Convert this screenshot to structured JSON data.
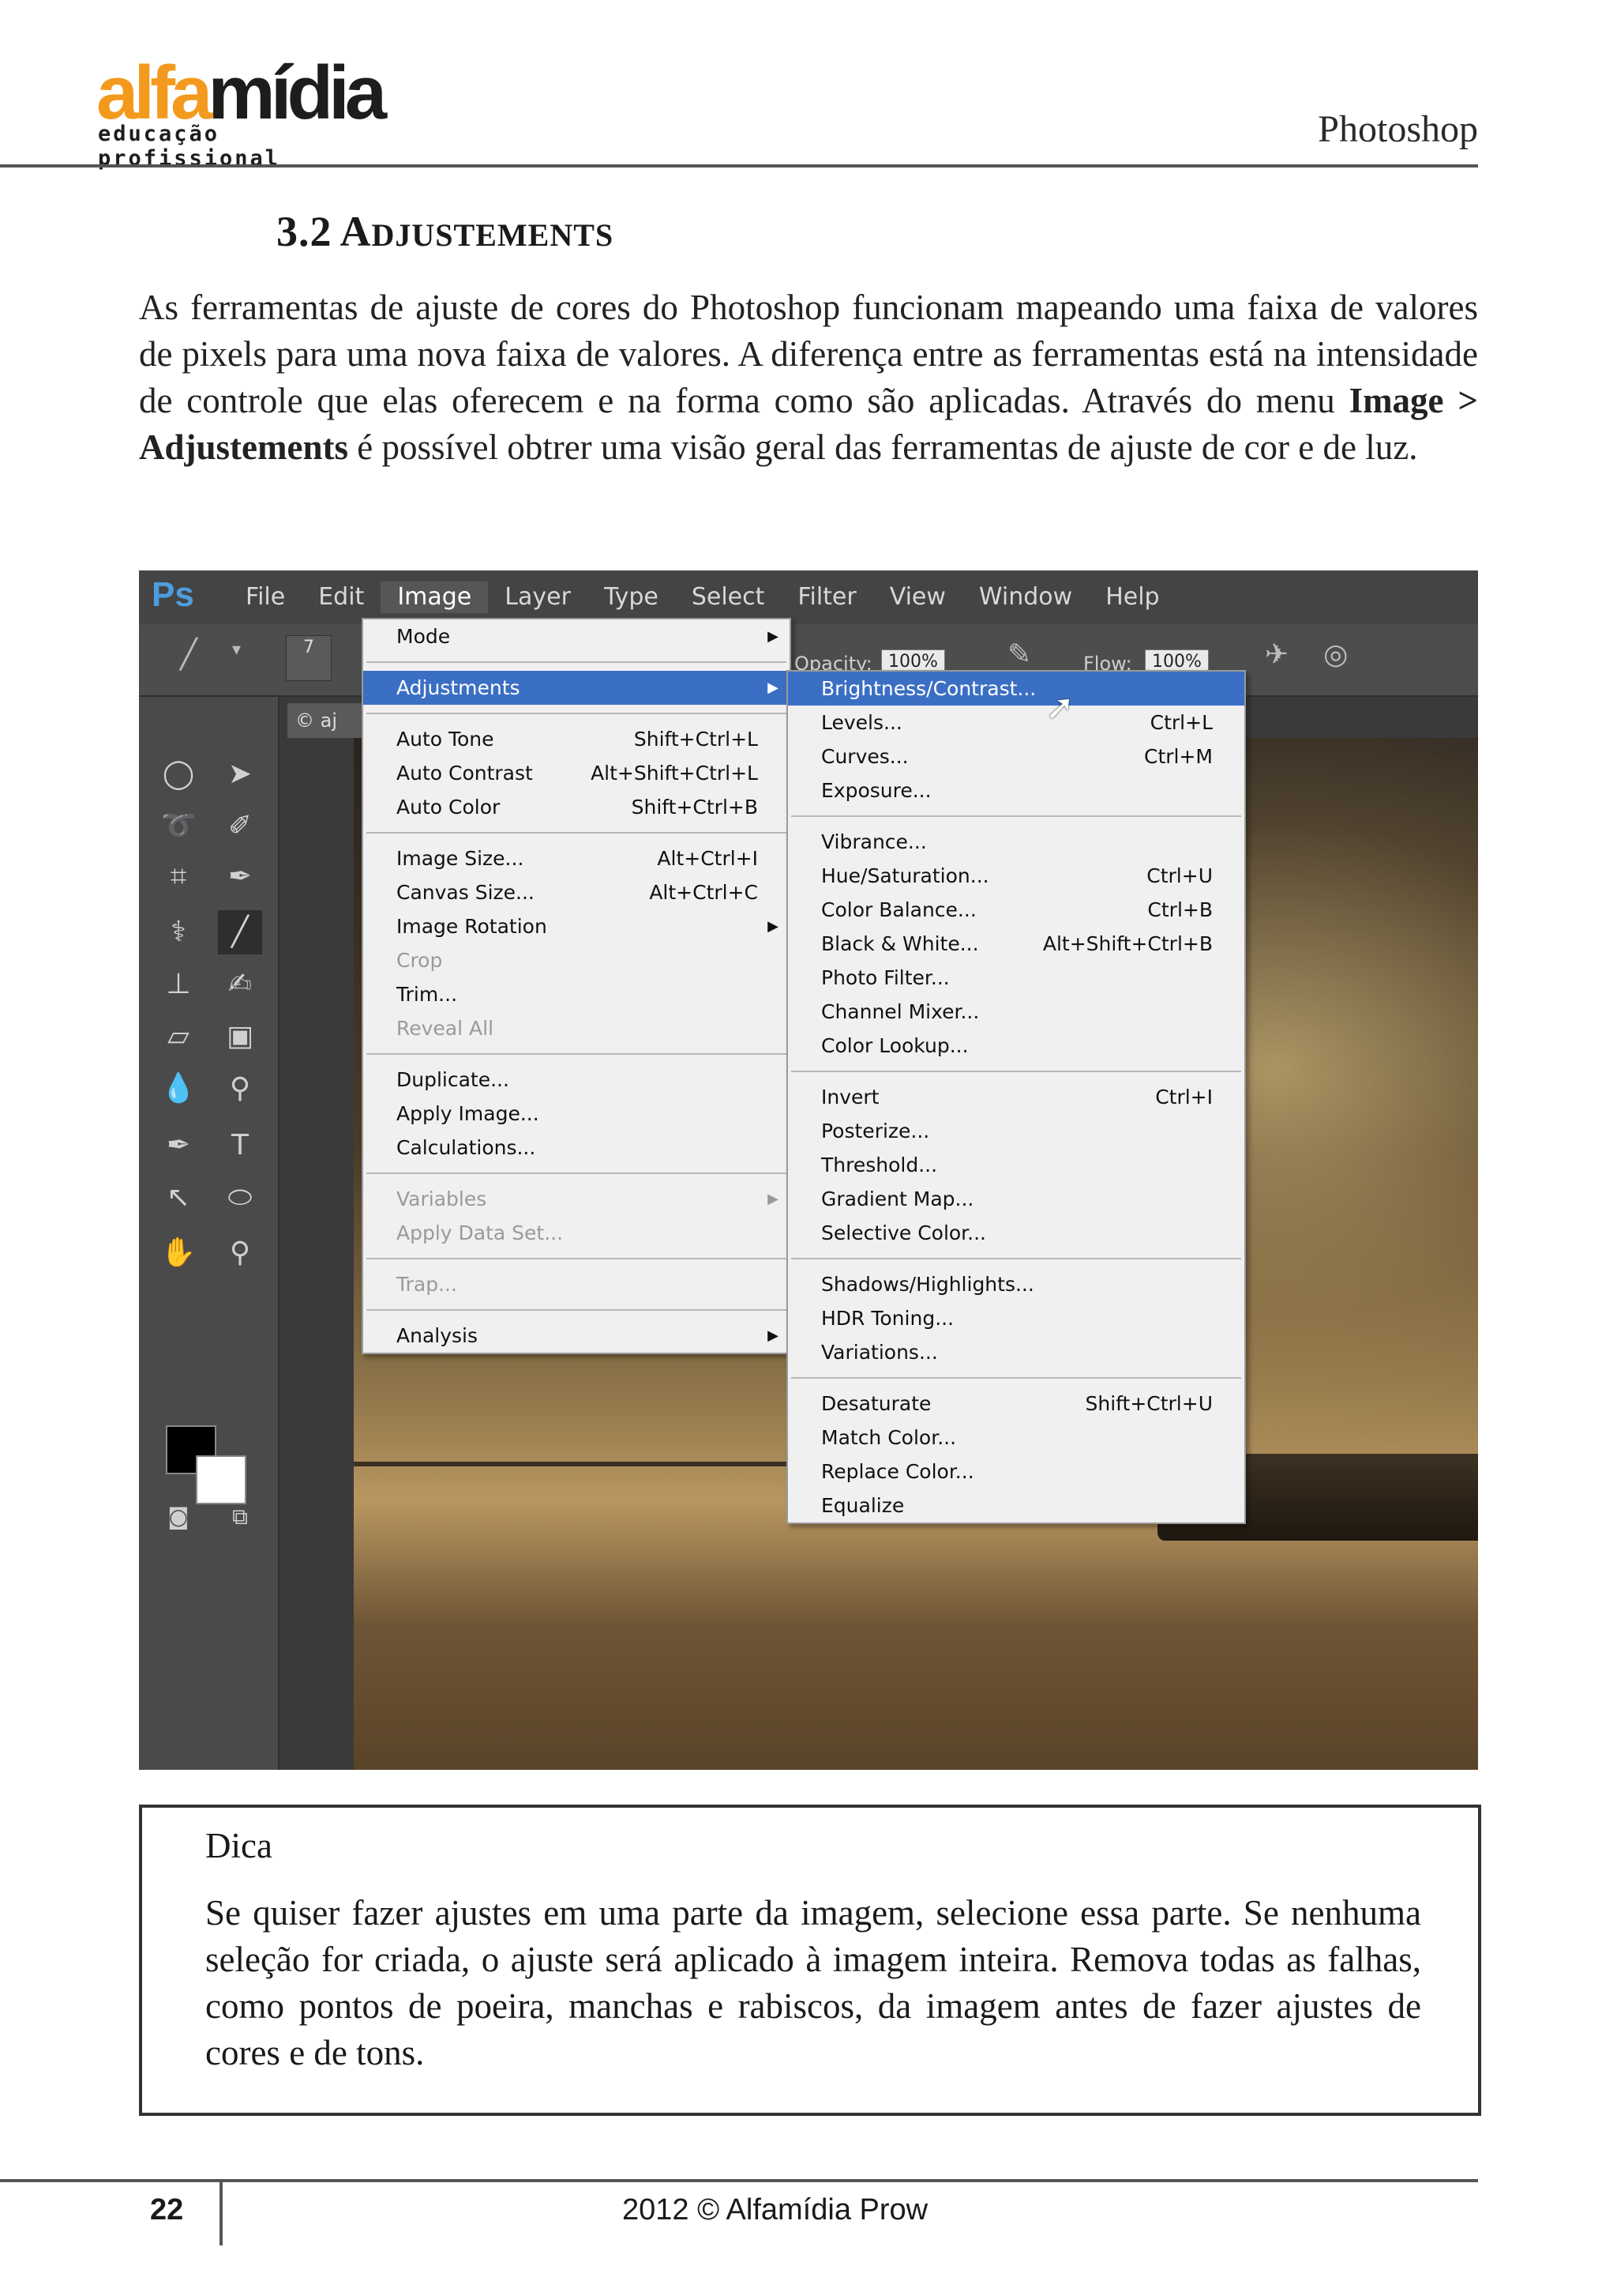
{
  "header": {
    "logo_part1": "alfa",
    "logo_part2": "mídia",
    "logo_tagline": "educação profissional",
    "title": "Photoshop"
  },
  "section": {
    "number": "3.2",
    "title_initial": "A",
    "title_rest": "DJUSTEMENTS"
  },
  "body": {
    "text_before": "As ferramentas de ajuste de cores do Photoshop funcionam mapeando uma faixa de valores de pixels para uma nova faixa de valores. A diferença entre as ferramentas está na intensidade de controle que elas oferecem e na forma como são aplicadas. Através do menu ",
    "bold_text": "Image > Adjustements",
    "text_after": " é possível obtrer uma visão geral das ferramentas de ajuste de cor e de luz."
  },
  "screenshot": {
    "ps_logo": "Ps",
    "menubar": [
      "File",
      "Edit",
      "Image",
      "Layer",
      "Type",
      "Select",
      "Filter",
      "View",
      "Window",
      "Help"
    ],
    "active_menu": "Image",
    "options": {
      "opacity_label": "Opacity:",
      "opacity_value": "100%",
      "flow_label": "Flow:",
      "flow_value": "100%",
      "brush_size": "7"
    },
    "doc_tab": "© aj",
    "image_menu": [
      {
        "label": "Mode",
        "shortcut": "",
        "submenu": true,
        "disabled": false
      },
      {
        "sep": true
      },
      {
        "label": "Adjustments",
        "shortcut": "",
        "submenu": true,
        "disabled": false,
        "highlight": true
      },
      {
        "sep": true
      },
      {
        "label": "Auto Tone",
        "shortcut": "Shift+Ctrl+L",
        "disabled": false
      },
      {
        "label": "Auto Contrast",
        "shortcut": "Alt+Shift+Ctrl+L",
        "disabled": false
      },
      {
        "label": "Auto Color",
        "shortcut": "Shift+Ctrl+B",
        "disabled": false
      },
      {
        "sep": true
      },
      {
        "label": "Image Size...",
        "shortcut": "Alt+Ctrl+I",
        "disabled": false
      },
      {
        "label": "Canvas Size...",
        "shortcut": "Alt+Ctrl+C",
        "disabled": false
      },
      {
        "label": "Image Rotation",
        "shortcut": "",
        "submenu": true,
        "disabled": false
      },
      {
        "label": "Crop",
        "shortcut": "",
        "disabled": true
      },
      {
        "label": "Trim...",
        "shortcut": "",
        "disabled": false
      },
      {
        "label": "Reveal All",
        "shortcut": "",
        "disabled": true
      },
      {
        "sep": true
      },
      {
        "label": "Duplicate...",
        "shortcut": "",
        "disabled": false
      },
      {
        "label": "Apply Image...",
        "shortcut": "",
        "disabled": false
      },
      {
        "label": "Calculations...",
        "shortcut": "",
        "disabled": false
      },
      {
        "sep": true
      },
      {
        "label": "Variables",
        "shortcut": "",
        "submenu": true,
        "disabled": true
      },
      {
        "label": "Apply Data Set...",
        "shortcut": "",
        "disabled": true
      },
      {
        "sep": true
      },
      {
        "label": "Trap...",
        "shortcut": "",
        "disabled": true
      },
      {
        "sep": true
      },
      {
        "label": "Analysis",
        "shortcut": "",
        "submenu": true,
        "disabled": false
      }
    ],
    "adjustments_menu": [
      {
        "label": "Brightness/Contrast...",
        "shortcut": "",
        "highlight": true
      },
      {
        "label": "Levels...",
        "shortcut": "Ctrl+L"
      },
      {
        "label": "Curves...",
        "shortcut": "Ctrl+M"
      },
      {
        "label": "Exposure...",
        "shortcut": ""
      },
      {
        "sep": true
      },
      {
        "label": "Vibrance...",
        "shortcut": ""
      },
      {
        "label": "Hue/Saturation...",
        "shortcut": "Ctrl+U"
      },
      {
        "label": "Color Balance...",
        "shortcut": "Ctrl+B"
      },
      {
        "label": "Black & White...",
        "shortcut": "Alt+Shift+Ctrl+B"
      },
      {
        "label": "Photo Filter...",
        "shortcut": ""
      },
      {
        "label": "Channel Mixer...",
        "shortcut": ""
      },
      {
        "label": "Color Lookup...",
        "shortcut": ""
      },
      {
        "sep": true
      },
      {
        "label": "Invert",
        "shortcut": "Ctrl+I"
      },
      {
        "label": "Posterize...",
        "shortcut": ""
      },
      {
        "label": "Threshold...",
        "shortcut": ""
      },
      {
        "label": "Gradient Map...",
        "shortcut": ""
      },
      {
        "label": "Selective Color...",
        "shortcut": ""
      },
      {
        "sep": true
      },
      {
        "label": "Shadows/Highlights...",
        "shortcut": ""
      },
      {
        "label": "HDR Toning...",
        "shortcut": ""
      },
      {
        "label": "Variations...",
        "shortcut": ""
      },
      {
        "sep": true
      },
      {
        "label": "Desaturate",
        "shortcut": "Shift+Ctrl+U"
      },
      {
        "label": "Match Color...",
        "shortcut": ""
      },
      {
        "label": "Replace Color...",
        "shortcut": ""
      },
      {
        "label": "Equalize",
        "shortcut": ""
      }
    ]
  },
  "tip": {
    "title": "Dica",
    "text": "Se quiser fazer ajustes em uma parte da imagem, selecione essa parte. Se nenhuma seleção for criada, o ajuste será aplicado à imagem inteira. Remova todas as falhas, como pontos de poeira, manchas e rabiscos, da imagem antes de fazer ajustes de cores e de tons."
  },
  "footer": {
    "page_number": "22",
    "copyright": "2012 © Alfamídia Prow"
  },
  "colors": {
    "logo_orange": "#f39a1e",
    "menu_highlight": "#3b6fc4",
    "ps_blue": "#4d9de0"
  }
}
